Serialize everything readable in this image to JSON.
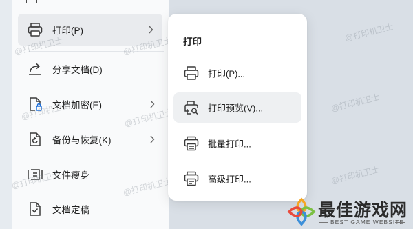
{
  "main_menu": {
    "items": [
      {
        "label": "打印(P)",
        "icon": "printer-icon",
        "has_submenu": true
      },
      {
        "label": "分享文档(D)",
        "icon": "share-icon",
        "has_submenu": false
      },
      {
        "label": "文档加密(E)",
        "icon": "encrypt-icon",
        "has_submenu": true
      },
      {
        "label": "备份与恢复(K)",
        "icon": "backup-icon",
        "has_submenu": true
      },
      {
        "label": "文件瘦身",
        "icon": "slim-icon",
        "has_submenu": false
      },
      {
        "label": "文档定稿",
        "icon": "finalize-icon",
        "has_submenu": false
      }
    ]
  },
  "submenu": {
    "title": "打印",
    "items": [
      {
        "label": "打印(P)...",
        "icon": "printer-icon"
      },
      {
        "label": "打印预览(V)...",
        "icon": "print-preview-icon"
      },
      {
        "label": "批量打印...",
        "icon": "batch-print-icon"
      },
      {
        "label": "高级打印...",
        "icon": "advanced-print-icon"
      }
    ]
  },
  "watermark": "@打印机卫士",
  "logo": {
    "title": "最佳游戏网",
    "subtitle": "BEST GAME WEBSITE",
    "colors": {
      "orange": "#f5a623",
      "green": "#7bc043",
      "blue": "#3b8fd9",
      "red": "#e94b3c"
    }
  },
  "colors": {
    "menu_bg": "#f9fafb",
    "highlight": "#e9ebee",
    "icon_stroke": "#3a3a3a",
    "text": "#1f1f1f"
  }
}
